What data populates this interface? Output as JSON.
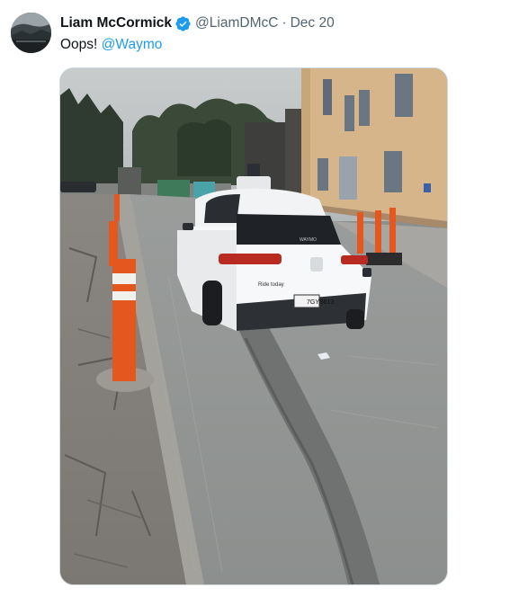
{
  "tweet": {
    "author": {
      "display_name": "Liam McCormick",
      "handle": "@LiamDMcC",
      "verified": true,
      "avatar_icon": "profile-photo-icon"
    },
    "separator": "·",
    "date": "Dec 20",
    "text": {
      "prefix": "Oops! ",
      "mention": "@Waymo"
    },
    "media": {
      "icon": "photo-icon",
      "plate_text": "7GYS613",
      "car_sticker": "Ride today",
      "car_brand": "WAYMO"
    }
  },
  "colors": {
    "text": "#0f1419",
    "secondary": "#536471",
    "link": "#1d9bf0",
    "verified": "#1d9bf0",
    "border": "#cfd9de"
  }
}
